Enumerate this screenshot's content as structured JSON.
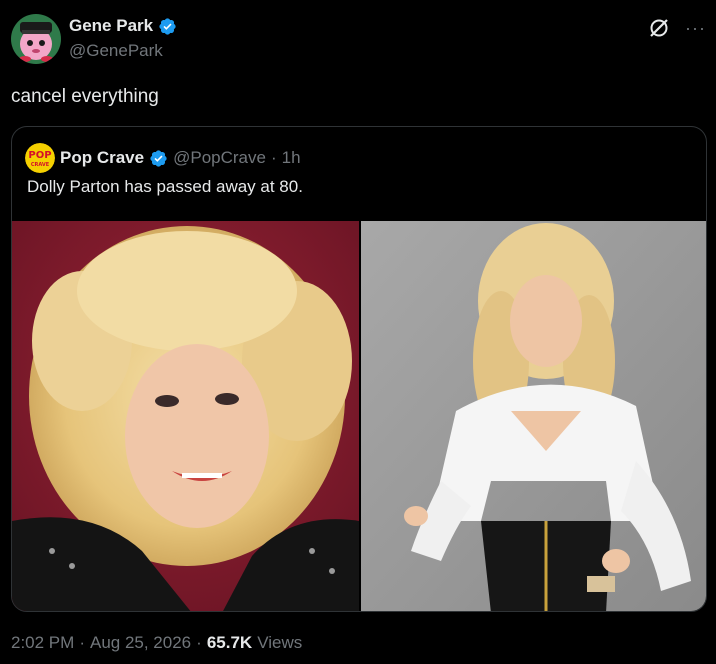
{
  "author": {
    "display_name": "Gene Park",
    "handle": "@GenePark",
    "verified": true,
    "avatar_icon": "avatar-cartoon-icon"
  },
  "tweet": {
    "text": "cancel everything"
  },
  "quoted": {
    "display_name": "Pop Crave",
    "handle": "@PopCrave",
    "separator": "·",
    "time": "1h",
    "verified": true,
    "text": "Dolly Parton has passed away at 80.",
    "avatar_text": "POP",
    "avatar_subtext": "CRAVE",
    "media": [
      {
        "kind": "photo",
        "background": "#7a1c2c"
      },
      {
        "kind": "photo",
        "background": "#9a9a9a"
      }
    ]
  },
  "footer": {
    "time": "2:02 PM",
    "sep1": "·",
    "date": "Aug 25, 2026",
    "sep2": "·",
    "views_count": "65.7K",
    "views_label": "Views"
  },
  "colors": {
    "background": "#000000",
    "text_primary": "#e7e9ea",
    "text_secondary": "#71767b",
    "border": "#2f3336",
    "verified_blue": "#1d9bf0"
  }
}
